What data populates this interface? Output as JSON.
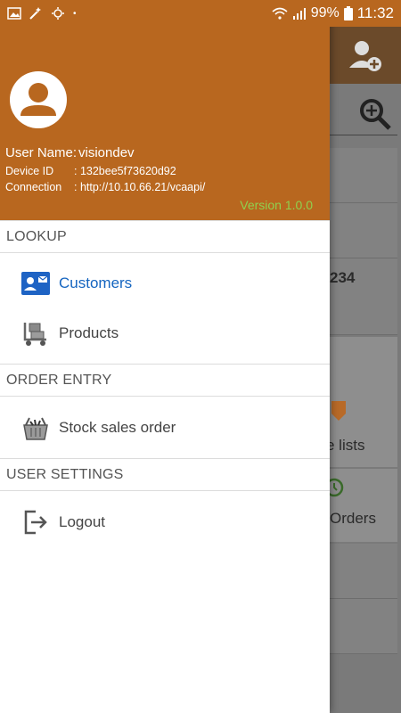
{
  "status_bar": {
    "battery": "99%",
    "time": "11:32"
  },
  "header": {
    "user_name_label": "User Name",
    "user_name": "visiondev",
    "device_id_label": "Device ID",
    "device_id": "132bee5f73620d92",
    "connection_label": "Connection",
    "connection": "http://10.10.66.21/vcaapi/",
    "version": "Version 1.0.0"
  },
  "sections": {
    "lookup": "LOOKUP",
    "order_entry": "ORDER ENTRY",
    "user_settings": "USER SETTINGS"
  },
  "menu": {
    "customers": "Customers",
    "products": "Products",
    "stock_sales_order": "Stock sales order",
    "logout": "Logout"
  },
  "background": {
    "card_number": "234",
    "price_lists": "e lists",
    "orders": "Orders"
  },
  "colors": {
    "header_bg": "#b8671f",
    "version": "#8fd14f",
    "active_item": "#1565c0"
  }
}
